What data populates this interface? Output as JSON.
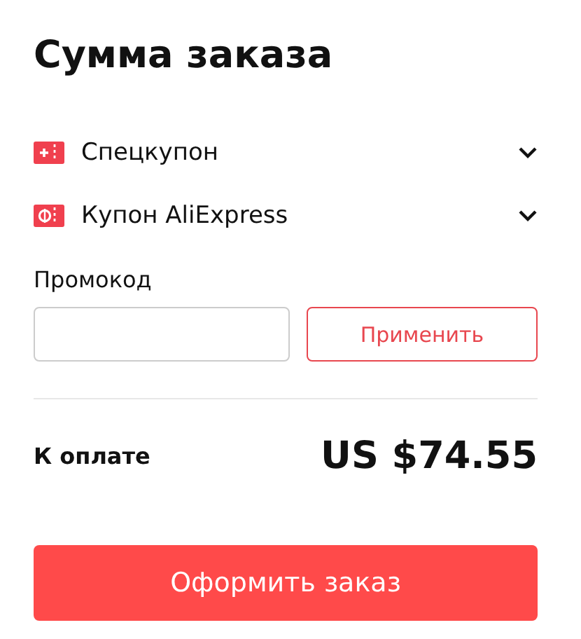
{
  "title": "Сумма заказа",
  "coupons": [
    {
      "kind": "special",
      "label": "Спецкупон",
      "expanded": false
    },
    {
      "kind": "platform",
      "label": "Купон AliExpress",
      "expanded": false
    }
  ],
  "promo": {
    "label": "Промокод",
    "apply_button": "Применить"
  },
  "total": {
    "label": "К оплате",
    "amount": "US $74.55"
  },
  "checkout_button": "Оформить заказ"
}
